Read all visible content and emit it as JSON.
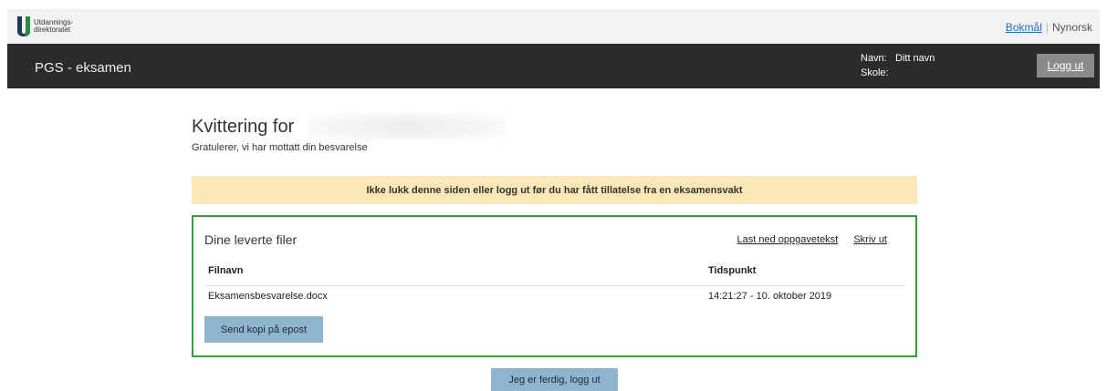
{
  "brand": {
    "logo_line1": "Utdannings-",
    "logo_line2": "direktoratet"
  },
  "language": {
    "active": "Bokmål",
    "other": "Nynorsk"
  },
  "header": {
    "app_title": "PGS - eksamen",
    "name_label": "Navn:",
    "name_value": "Ditt navn",
    "school_label": "Skole:",
    "school_value": "",
    "logout_label": "Logg ut"
  },
  "receipt": {
    "title": "Kvittering for",
    "subtitle": "Gratulerer, vi har mottatt din besvarelse",
    "warning": "Ikke lukk denne siden eller logg ut før du har fått tillatelse fra en eksamensvakt"
  },
  "files": {
    "title": "Dine leverte filer",
    "link_download": "Last ned oppgavetekst",
    "link_print": "Skriv ut",
    "columns": {
      "name": "Filnavn",
      "time": "Tidspunkt"
    },
    "rows": [
      {
        "name": "Eksamensbesvarelse.docx",
        "time": "14:21:27 - 10. oktober 2019"
      }
    ],
    "send_copy_label": "Send kopi på epost"
  },
  "done_label": "Jeg er ferdig, logg ut",
  "colors": {
    "header_bg": "#2b2b2b",
    "warning_bg": "#fce8b6",
    "box_border": "#3e9a3e",
    "button_bg": "#8fb4cf"
  }
}
